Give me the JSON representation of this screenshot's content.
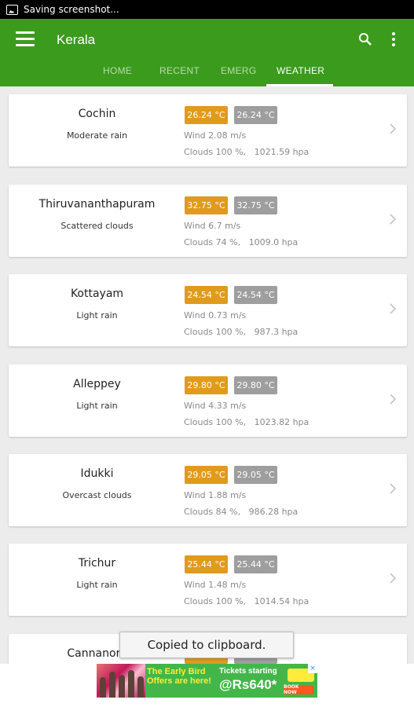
{
  "status_bar": {
    "text": "Saving screenshot..."
  },
  "app_bar": {
    "title": "Kerala"
  },
  "tabs": [
    {
      "label": "HOME",
      "active": false
    },
    {
      "label": "RECENT",
      "active": false
    },
    {
      "label": "EMERG",
      "active": false
    },
    {
      "label": "WEATHER",
      "active": true
    }
  ],
  "weather": [
    {
      "city": "Cochin",
      "desc": "Moderate rain",
      "temp1": "26.24 °C",
      "temp2": "26.24 °C",
      "wind": "Wind 2.08 m/s",
      "clouds": "Clouds 100 %,   1021.59 hpa"
    },
    {
      "city": "Thiruvananthapuram",
      "desc": "Scattered clouds",
      "temp1": "32.75 °C",
      "temp2": "32.75 °C",
      "wind": "Wind 6.7 m/s",
      "clouds": "Clouds 74 %,   1009.0 hpa"
    },
    {
      "city": "Kottayam",
      "desc": "Light rain",
      "temp1": "24.54 °C",
      "temp2": "24.54 °C",
      "wind": "Wind 0.73 m/s",
      "clouds": "Clouds 100 %,   987.3 hpa"
    },
    {
      "city": "Alleppey",
      "desc": "Light rain",
      "temp1": "29.80 °C",
      "temp2": "29.80 °C",
      "wind": "Wind 4.33 m/s",
      "clouds": "Clouds 100 %,   1023.82 hpa"
    },
    {
      "city": "Idukki",
      "desc": "Overcast clouds",
      "temp1": "29.05 °C",
      "temp2": "29.05 °C",
      "wind": "Wind 1.88 m/s",
      "clouds": "Clouds 84 %,   986.28 hpa"
    },
    {
      "city": "Trichur",
      "desc": "Light rain",
      "temp1": "25.44 °C",
      "temp2": "25.44 °C",
      "wind": "Wind 1.48 m/s",
      "clouds": "Clouds 100 %,   1014.54 hpa"
    },
    {
      "city": "Cannanore",
      "desc": "",
      "temp1": "",
      "temp2": "",
      "wind": "",
      "clouds": ""
    }
  ],
  "toast": {
    "text": "Copied to clipboard."
  },
  "ad": {
    "headline": "The Early Bird Offers are here!",
    "tickets": "Tickets starting",
    "price": "@Rs640*",
    "cta": "BOOK NOW",
    "close": "×"
  },
  "icons": {
    "menu": "menu-icon",
    "search": "search-icon",
    "more": "more-vert-icon",
    "chevron": "chevron-right-icon"
  },
  "colors": {
    "app_bar": "#3b9b1d",
    "temp_primary": "#e09b1c",
    "temp_secondary": "#9e9e9e"
  }
}
